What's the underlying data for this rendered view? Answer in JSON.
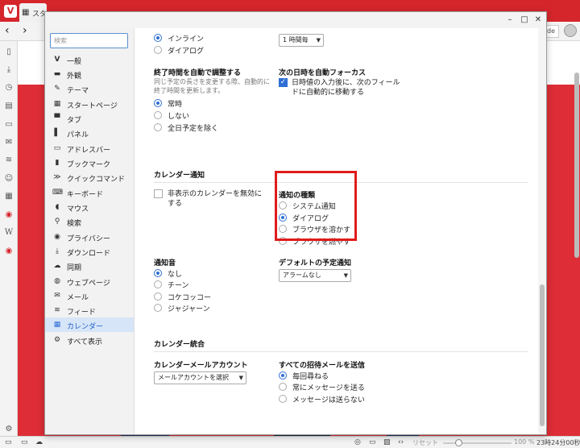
{
  "browser": {
    "tab_label": "スタ",
    "url_fragment": "de",
    "colors": {
      "brand_red": "#d5262c",
      "accent_blue": "#2f6ed5",
      "highlight_red": "#e01b1b"
    }
  },
  "settings": {
    "search_placeholder": "検索",
    "nav_items": [
      {
        "label": "一般",
        "icon": "vivaldi-icon"
      },
      {
        "label": "外観",
        "icon": "folder-icon"
      },
      {
        "label": "テーマ",
        "icon": "brush-icon"
      },
      {
        "label": "スタートページ",
        "icon": "grid-icon"
      },
      {
        "label": "タブ",
        "icon": "tab-icon"
      },
      {
        "label": "パネル",
        "icon": "panel-icon"
      },
      {
        "label": "アドレスバー",
        "icon": "address-bar-icon"
      },
      {
        "label": "ブックマーク",
        "icon": "bookmark-icon"
      },
      {
        "label": "クイックコマンド",
        "icon": "quick-command-icon"
      },
      {
        "label": "キーボード",
        "icon": "keyboard-icon"
      },
      {
        "label": "マウス",
        "icon": "mouse-icon"
      },
      {
        "label": "検索",
        "icon": "search-icon"
      },
      {
        "label": "プライバシー",
        "icon": "eye-icon"
      },
      {
        "label": "ダウンロード",
        "icon": "download-icon"
      },
      {
        "label": "同期",
        "icon": "cloud-icon"
      },
      {
        "label": "ウェブページ",
        "icon": "globe-icon"
      },
      {
        "label": "メール",
        "icon": "mail-icon"
      },
      {
        "label": "フィード",
        "icon": "rss-icon"
      },
      {
        "label": "カレンダー",
        "icon": "calendar-icon",
        "active": true
      },
      {
        "label": "すべて表示",
        "icon": "gear-icon"
      }
    ],
    "top_section": {
      "opt_inline": "インライン",
      "opt_dialog": "ダイアログ",
      "interval_select": "1 時間毎"
    },
    "end_time": {
      "title": "終了時間を自動で調整する",
      "desc": "同じ予定の長さを変更する際、自動的に終了時間を更新します。",
      "opt_always": "常時",
      "opt_never": "しない",
      "opt_except_allday": "全日予定を除く"
    },
    "next_focus": {
      "title": "次の日時を自動フォーカス",
      "checkbox_label": "日時値の入力後に、次のフィールドに自動的に移動する"
    },
    "calendar_notification": {
      "section_title": "カレンダー通知",
      "disable_hidden_label": "非表示のカレンダーを無効にする",
      "type_title": "通知の種類",
      "opt_system": "システム通知",
      "opt_dialog": "ダイアログ",
      "opt_melt": "ブラウザを溶かす",
      "opt_burn": "ブラウザを燃やす"
    },
    "sound": {
      "title": "通知音",
      "opt_none": "なし",
      "opt_chime": "チーン",
      "opt_kokekokko": "コケコッコー",
      "opt_jajan": "ジャジャーン"
    },
    "default_notification": {
      "title": "デフォルトの予定通知",
      "select_value": "アラームなし"
    },
    "calendar_integration": {
      "section_title": "カレンダー統合",
      "mail_account_title": "カレンダーメールアカウント",
      "mail_account_select": "メールアカウントを選択",
      "send_invites_title": "すべての招待メールを送信",
      "opt_ask": "毎回尋ねる",
      "opt_always_message": "常にメッセージを送る",
      "opt_no_message": "メッセージは送らない"
    }
  },
  "statusbar": {
    "reset_label": "リセット",
    "zoom": "100 %",
    "clock": "23時24分00秒"
  }
}
